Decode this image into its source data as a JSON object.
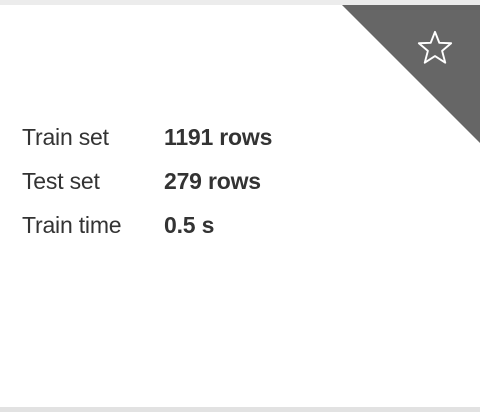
{
  "corner": {
    "icon": "star-icon",
    "color": "#666666"
  },
  "stats": [
    {
      "label": "Train set",
      "value": "1191 rows"
    },
    {
      "label": "Test set",
      "value": "279 rows"
    },
    {
      "label": "Train time",
      "value": "0.5 s"
    }
  ]
}
